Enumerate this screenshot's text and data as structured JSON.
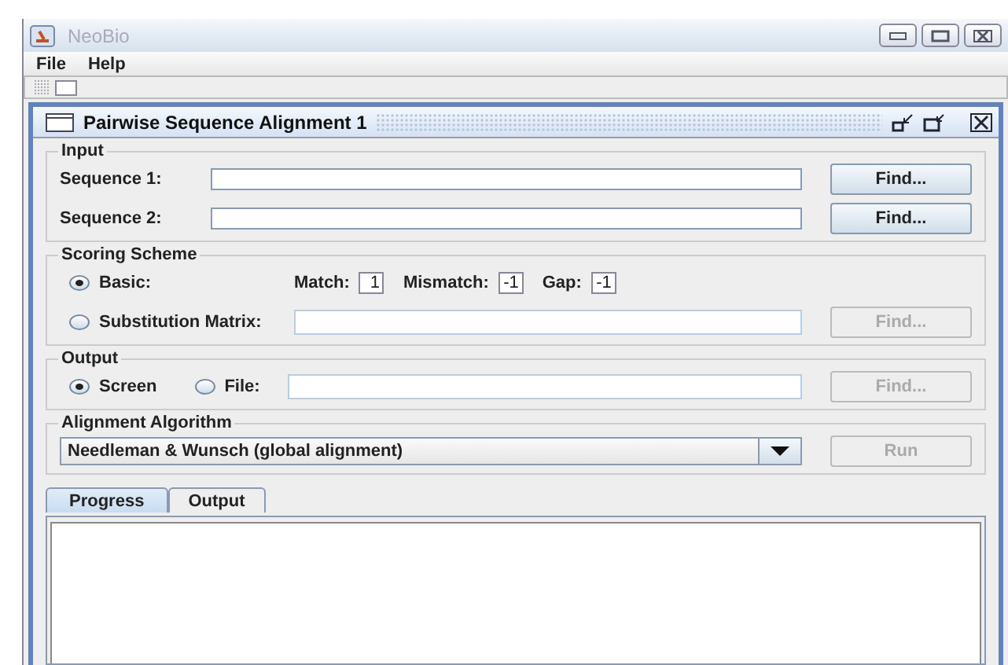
{
  "window": {
    "title": "NeoBio"
  },
  "menu": [
    {
      "label": "File"
    },
    {
      "label": "Help"
    }
  ],
  "frame": {
    "title": "Pairwise Sequence Alignment 1"
  },
  "input": {
    "title": "Input",
    "rows": [
      {
        "label": "Sequence 1:",
        "button": "Find...",
        "disabled": false
      },
      {
        "label": "Sequence 2:",
        "button": "Find...",
        "disabled": false
      }
    ]
  },
  "scoring": {
    "title": "Scoring Scheme",
    "options": [
      {
        "label": "Basic:",
        "selected": true
      },
      {
        "label": "Substitution Matrix:",
        "selected": false
      }
    ],
    "params": [
      {
        "label": "Match:",
        "value": "1"
      },
      {
        "label": "Mismatch:",
        "value": "-1"
      },
      {
        "label": "Gap:",
        "value": "-1"
      }
    ],
    "button": "Find...",
    "disabled": true
  },
  "output": {
    "title": "Output",
    "options": [
      {
        "label": "Screen",
        "selected": true
      },
      {
        "label": "File:",
        "selected": false
      }
    ],
    "button": "Find...",
    "disabled": true
  },
  "algorithm": {
    "title": "Alignment Algorithm",
    "value": "Needleman & Wunsch (global alignment)",
    "button": "Run",
    "disabled": true
  },
  "tabs": [
    {
      "label": "Progress",
      "selected": true
    },
    {
      "label": "Output",
      "selected": false
    }
  ]
}
